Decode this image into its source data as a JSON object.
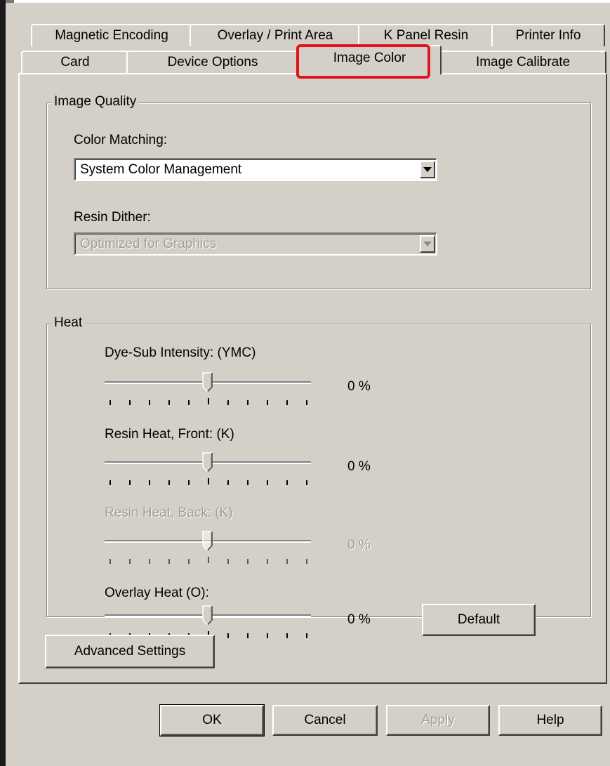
{
  "tabs": {
    "row_back": [
      {
        "label": "Magnetic Encoding"
      },
      {
        "label": "Overlay / Print Area"
      },
      {
        "label": "K Panel Resin"
      },
      {
        "label": "Printer Info"
      }
    ],
    "row_front": [
      {
        "label": "Card"
      },
      {
        "label": "Device Options"
      },
      {
        "label": "Image Color",
        "selected": true
      },
      {
        "label": "Image Calibrate"
      }
    ]
  },
  "image_quality": {
    "title": "Image Quality",
    "color_matching_label": "Color Matching:",
    "color_matching_value": "System Color Management",
    "resin_dither_label": "Resin Dither:",
    "resin_dither_value": "Optimized for Graphics",
    "resin_dither_enabled": false
  },
  "heat": {
    "title": "Heat",
    "sliders": [
      {
        "label": "Dye-Sub Intensity: (YMC)",
        "value": "0 %",
        "position": 0.5,
        "enabled": true
      },
      {
        "label": "Resin Heat, Front: (K)",
        "value": "0 %",
        "position": 0.5,
        "enabled": true
      },
      {
        "label": "Resin Heat, Back: (K)",
        "value": "0 %",
        "position": 0.5,
        "enabled": false
      },
      {
        "label": "Overlay Heat  (O):",
        "value": "0 %",
        "position": 0.5,
        "enabled": true
      }
    ],
    "default_button": "Default"
  },
  "advanced_settings_button": "Advanced Settings",
  "dialog_buttons": {
    "ok": "OK",
    "cancel": "Cancel",
    "apply": "Apply",
    "apply_enabled": false,
    "help": "Help"
  },
  "colors": {
    "face": "#d4d0c8",
    "highlight_box": "#e0141e"
  }
}
